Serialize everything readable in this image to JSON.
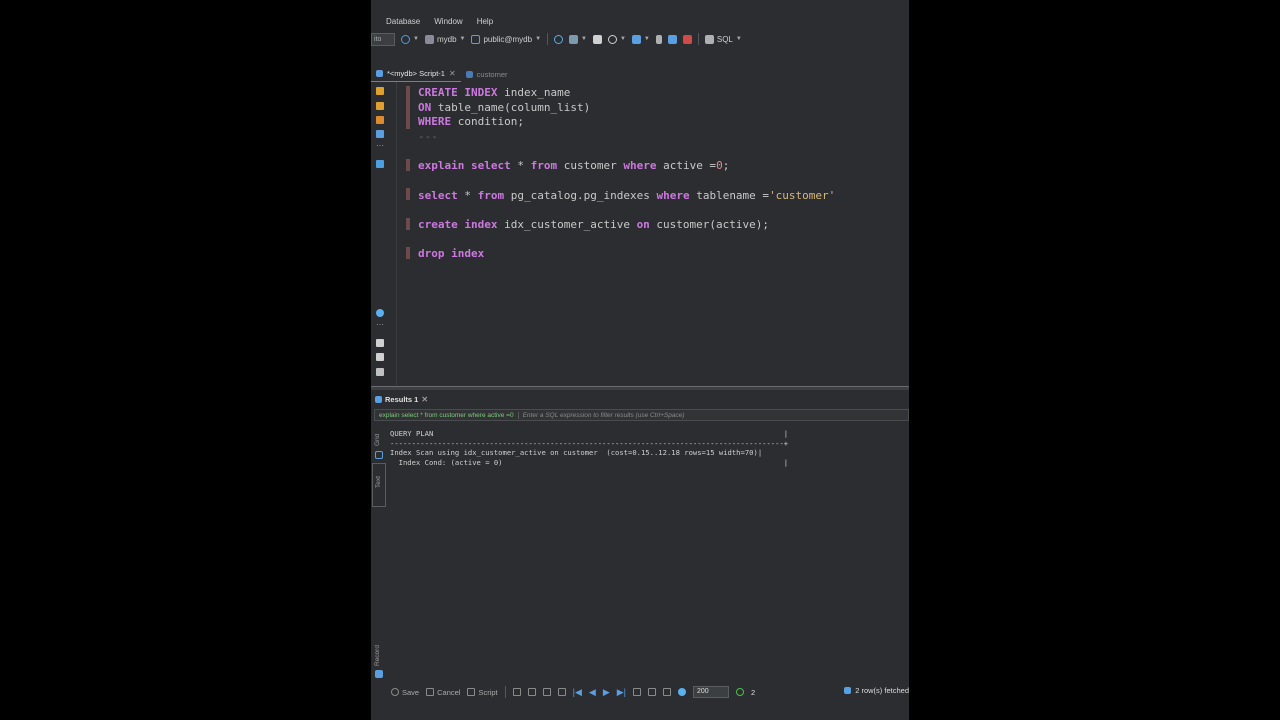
{
  "menu": [
    "Database",
    "Window",
    "Help"
  ],
  "toolbar": {
    "field_value": "ito",
    "database": "mydb",
    "schema": "public@mydb",
    "sql_label": "SQL"
  },
  "tabs": [
    {
      "label": "*<mydb> Script-1",
      "active": true
    },
    {
      "label": "customer",
      "active": false
    }
  ],
  "editor": {
    "lines": [
      [
        {
          "t": "CREATE INDEX",
          "c": "kw"
        },
        {
          "t": " index_name",
          "c": ""
        }
      ],
      [
        {
          "t": "ON",
          "c": "kw"
        },
        {
          "t": " table_name(column_list)",
          "c": ""
        }
      ],
      [
        {
          "t": "WHERE",
          "c": "kw"
        },
        {
          "t": " condition;",
          "c": ""
        }
      ],
      [
        {
          "t": "---",
          "c": "cm"
        }
      ],
      [],
      [
        {
          "t": "explain select",
          "c": "kw"
        },
        {
          "t": " * ",
          "c": ""
        },
        {
          "t": "from",
          "c": "kw"
        },
        {
          "t": " customer ",
          "c": ""
        },
        {
          "t": "where",
          "c": "kw"
        },
        {
          "t": " active =",
          "c": ""
        },
        {
          "t": "0",
          "c": "num"
        },
        {
          "t": ";",
          "c": ""
        }
      ],
      [],
      [
        {
          "t": "select",
          "c": "kw"
        },
        {
          "t": " * ",
          "c": ""
        },
        {
          "t": "from",
          "c": "kw"
        },
        {
          "t": " pg_catalog.pg_indexes ",
          "c": ""
        },
        {
          "t": "where",
          "c": "kw"
        },
        {
          "t": " tablename =",
          "c": ""
        },
        {
          "t": "'customer'",
          "c": "str"
        }
      ],
      [],
      [
        {
          "t": "create index",
          "c": "kw"
        },
        {
          "t": " idx_customer_active ",
          "c": ""
        },
        {
          "t": "on",
          "c": "kw"
        },
        {
          "t": " customer(active);",
          "c": ""
        }
      ],
      [],
      [
        {
          "t": "drop index",
          "c": "kw"
        }
      ]
    ]
  },
  "results": {
    "tab_label": "Results 1",
    "filter_query": "explain select * from customer where active =0",
    "filter_placeholder": "Enter a SQL expression to filter results (use Ctrl+Space)",
    "side_tabs": [
      "Grid",
      "Text",
      "Record"
    ],
    "text_lines": [
      "QUERY PLAN                                                                                 |",
      "-------------------------------------------------------------------------------------------+",
      "Index Scan using idx_customer_active on customer  (cost=0.15..12.18 rows=15 width=70)|",
      "  Index Cond: (active = 0)                                                                 |"
    ]
  },
  "status": {
    "save": "Save",
    "cancel": "Cancel",
    "script": "Script",
    "fetch_size": "200",
    "count": "2",
    "rows_info": "2 row(s) fetched"
  }
}
